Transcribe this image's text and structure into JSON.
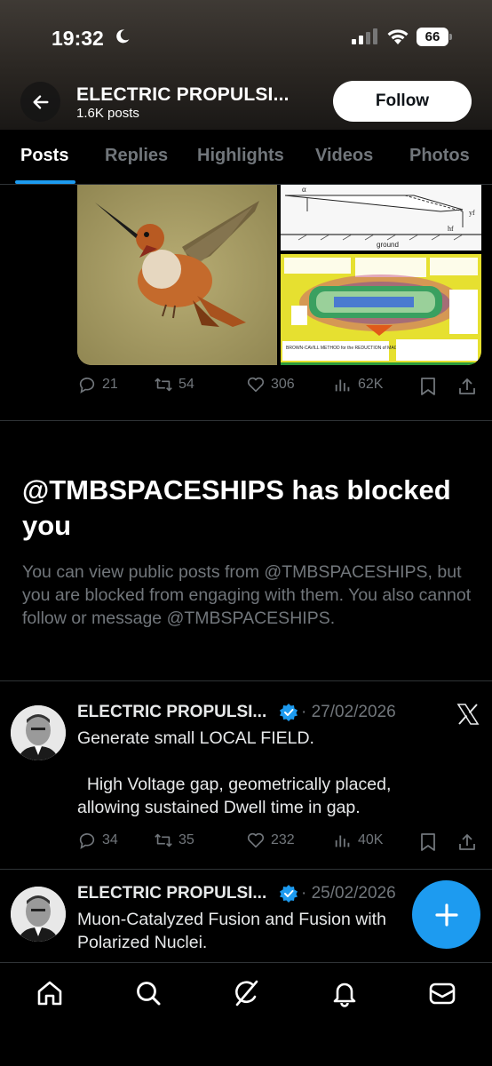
{
  "status_bar": {
    "time": "19:32",
    "battery": "66",
    "icons": [
      "moon-icon",
      "cellular-signal-icon",
      "wifi-icon",
      "battery-icon"
    ]
  },
  "header": {
    "name": "ELECTRIC PROPULSI...",
    "posts_count": "1.6K posts",
    "follow_label": "Follow"
  },
  "tabs": [
    {
      "label": "Posts",
      "active": true
    },
    {
      "label": "Replies",
      "active": false
    },
    {
      "label": "Highlights",
      "active": false
    },
    {
      "label": "Videos",
      "active": false
    },
    {
      "label": "Photos",
      "active": false
    }
  ],
  "media_post": {
    "diagram_labels": {
      "alpha": "α",
      "yf": "yf",
      "hf": "hf",
      "ground": "ground"
    },
    "poster_caption": "BROWN-CAVILL METHOD for the REDUCTION of MAGNETIC PERMITTIVITY of FREE SPACE",
    "replies": "21",
    "reposts": "54",
    "likes": "306",
    "views": "62K"
  },
  "blocked": {
    "title": "@TMBSPACESHIPS has blocked you",
    "body": "You can view public posts from @TMBSPACESHIPS, but you are blocked from engaging with them. You also cannot follow or message @TMBSPACESHIPS."
  },
  "posts": [
    {
      "author": "ELECTRIC PROPULSI...",
      "date": "· 27/02/2026",
      "text": "Generate small LOCAL FIELD.\n\n  High Voltage gap, geometrically placed, allowing sustained Dwell time in gap.",
      "replies": "34",
      "reposts": "35",
      "likes": "232",
      "views": "40K"
    },
    {
      "author": "ELECTRIC PROPULSI...",
      "date": "· 25/02/2026",
      "text": "Muon-Catalyzed Fusion and Fusion with Polarized Nuclei."
    }
  ],
  "colors": {
    "accent": "#1d9bf0",
    "muted": "#71767b",
    "divider": "#2f3336",
    "background": "#000000"
  },
  "bottom_nav": [
    "home-icon",
    "search-icon",
    "grok-icon",
    "notifications-icon",
    "messages-icon"
  ]
}
